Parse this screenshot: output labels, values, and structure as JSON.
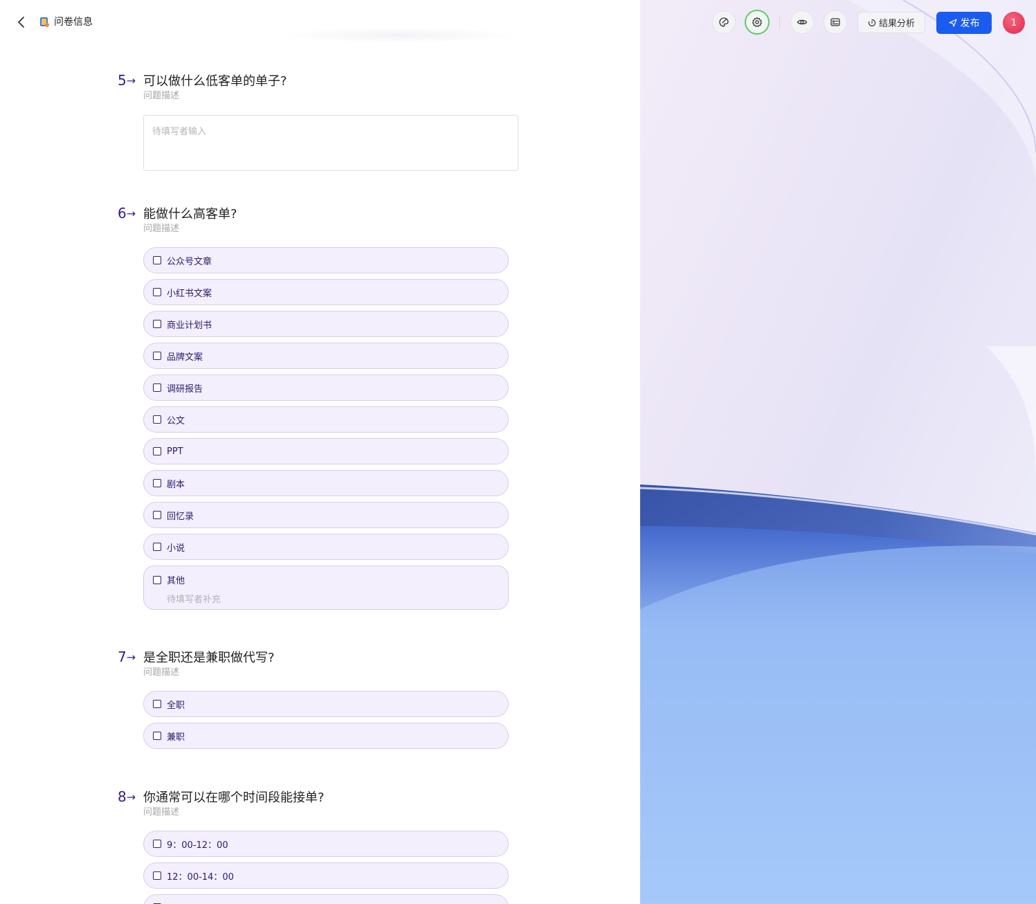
{
  "header": {
    "title": "问卷信息"
  },
  "toolbar": {
    "analysis_label": "结果分析",
    "publish_label": "发布",
    "avatar_badge": "1"
  },
  "questions": [
    {
      "number": "5",
      "title": "可以做什么低客单的单子?",
      "description": "问题描述",
      "input_placeholder": "待填写者输入"
    },
    {
      "number": "6",
      "title": "能做什么高客单?",
      "description": "问题描述",
      "options": [
        "公众号文章",
        "小红书文案",
        "商业计划书",
        "品牌文案",
        "调研报告",
        "公文",
        "PPT",
        "剧本",
        "回忆录",
        "小说",
        "其他"
      ],
      "other_placeholder": "待填写者补充"
    },
    {
      "number": "7",
      "title": "是全职还是兼职做代写?",
      "description": "问题描述",
      "options": [
        "全职",
        "兼职"
      ]
    },
    {
      "number": "8",
      "title": "你通常可以在哪个时间段能接单?",
      "description": "问题描述",
      "options": [
        "9：00-12：00",
        "12：00-14：00"
      ]
    }
  ],
  "colors": {
    "accent": "#3b1a8f",
    "publish": "#1b5cf0",
    "option_bg": "#f3effc",
    "option_border": "#d6cdee",
    "active_ring": "#5ccb6a",
    "avatar": "#e83a5a"
  },
  "icons": {
    "back": "chevron-left-icon",
    "logo": "app-logo-icon",
    "theme": "palette-icon",
    "settings": "gear-icon",
    "preview": "eye-icon",
    "outline": "card-list-icon",
    "analysis": "timer-icon",
    "publish": "send-icon"
  }
}
